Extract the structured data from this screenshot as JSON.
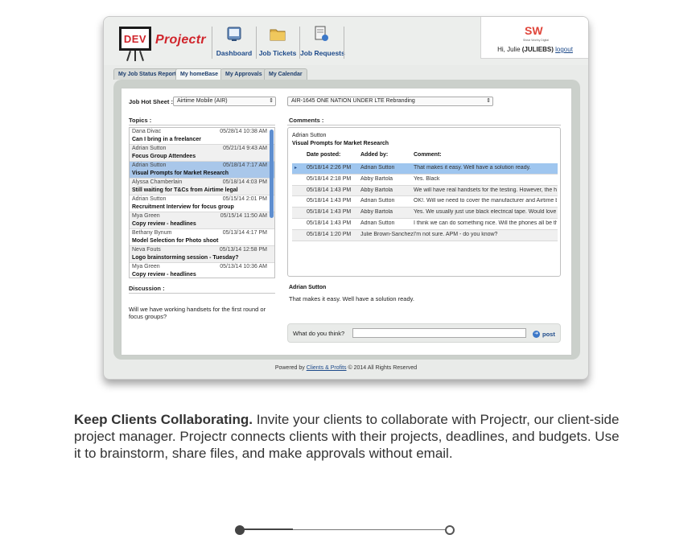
{
  "header": {
    "logo_badge": "DEV",
    "brand": "Projectr",
    "nav": [
      {
        "label": "Dashboard",
        "icon": "dashboard-icon"
      },
      {
        "label": "Job Tickets",
        "icon": "folder-icon"
      },
      {
        "label": "Job Requests",
        "icon": "job-request-icon"
      }
    ],
    "partner_logo": "SW",
    "partner_tagline": "Shear Worthy Digital",
    "user_greeting": "Hi, Julie",
    "user_handle": "(JULIEBS)",
    "logout": "logout"
  },
  "tabs": [
    {
      "label": "My Job Status Report",
      "active": false
    },
    {
      "label": "My homeBase",
      "active": true
    },
    {
      "label": "My Approvals",
      "active": false
    },
    {
      "label": "My Calendar",
      "active": false
    }
  ],
  "filters": {
    "hot_sheet_label": "Job Hot Sheet :",
    "hot_sheet_value": "Airtime Mobile (AIR)",
    "job_value": "AIR-1645 ONE NATION UNDER LTE Rebranding"
  },
  "topics": {
    "label": "Topics :",
    "items": [
      {
        "name": "Dana Divac",
        "date": "05/28/14 10:38 AM",
        "title": "Can I bring in a freelancer"
      },
      {
        "name": "Adrian Sutton",
        "date": "05/21/14 9:43 AM",
        "title": "Focus Group Attendees"
      },
      {
        "name": "Adrian Sutton",
        "date": "05/18/14 7:17 AM",
        "title": "Visual Prompts for Market Research"
      },
      {
        "name": "Alyssa Chamberlain",
        "date": "05/18/14 4:03 PM",
        "title": "Still waiting for T&Cs from Airtime legal"
      },
      {
        "name": "Adrian Sutton",
        "date": "05/15/14 2:01 PM",
        "title": "Recruitment Interview for focus group"
      },
      {
        "name": "Mya Green",
        "date": "05/15/14 11:50 AM",
        "title": "Copy review - headlines"
      },
      {
        "name": "Bethany Bynum",
        "date": "05/13/14 4:17 PM",
        "title": "Model Selection for Photo shoot"
      },
      {
        "name": "Neva Fouts",
        "date": "05/13/14 12:58 PM",
        "title": "Logo brainstorming session - Tuesday?"
      },
      {
        "name": "Mya Green",
        "date": "05/13/14 10:36 AM",
        "title": "Copy review - headlines"
      }
    ]
  },
  "discussion": {
    "label": "Discussion :",
    "text": "Will we have working handsets for the first round or focus groups?"
  },
  "comments": {
    "label": "Comments :",
    "author": "Adrian Sutton",
    "title": "Visual Prompts for Market Research",
    "col_date": "Date posted:",
    "col_added": "Added by:",
    "col_comment": "Comment:",
    "rows": [
      {
        "marker": "▸",
        "date": "05/18/14 2:26 PM",
        "by": "Adrian Sutton",
        "text": "That makes it easy. Well have a solution ready."
      },
      {
        "marker": "",
        "date": "05/18/14 2:18 PM",
        "by": "Abby Bartola",
        "text": "Yes. Black"
      },
      {
        "marker": "",
        "date": "05/18/14 1:43 PM",
        "by": "Abby Bartola",
        "text": "We will have real handsets for the testing. However, the h..."
      },
      {
        "marker": "",
        "date": "05/18/14 1:43 PM",
        "by": "Adrian Sutton",
        "text": "OK!. Will we need to cover the manufacturer and Airtime b..."
      },
      {
        "marker": "",
        "date": "05/18/14 1:43 PM",
        "by": "Abby Bartola",
        "text": "Yes. We usually just use black electrical tape. Would love it..."
      },
      {
        "marker": "",
        "date": "05/18/14 1:43 PM",
        "by": "Adrian Sutton",
        "text": "I think we can do something nice. Will the phones all be th..."
      },
      {
        "marker": "",
        "date": "05/18/14 1:20 PM",
        "by": "Julie Brown-Sanchez",
        "text": "I'm not sure. APM - do you know?"
      }
    ]
  },
  "detail": {
    "author": "Adrian Sutton",
    "text": "That makes it easy. Well have a solution ready."
  },
  "reply": {
    "label": "What do you think?",
    "placeholder": "",
    "post": "post"
  },
  "footer": {
    "prefix": "Powered by",
    "link": "Clients & Profits",
    "suffix": "© 2014 All Rights Reserved"
  },
  "caption": {
    "bold": "Keep Clients Collaborating.",
    "text": "Invite your clients to collaborate with Projectr, our client-side project manager.  Projectr connects clients with their projects, deadlines, and budgets. Use it to brainstorm, share files, and make approvals without email."
  },
  "pager": {
    "current": 1,
    "total": 2
  },
  "colors": {
    "brand_red": "#d0242b",
    "link_blue": "#1d4a8a",
    "selection_blue": "#a9c7ea"
  }
}
